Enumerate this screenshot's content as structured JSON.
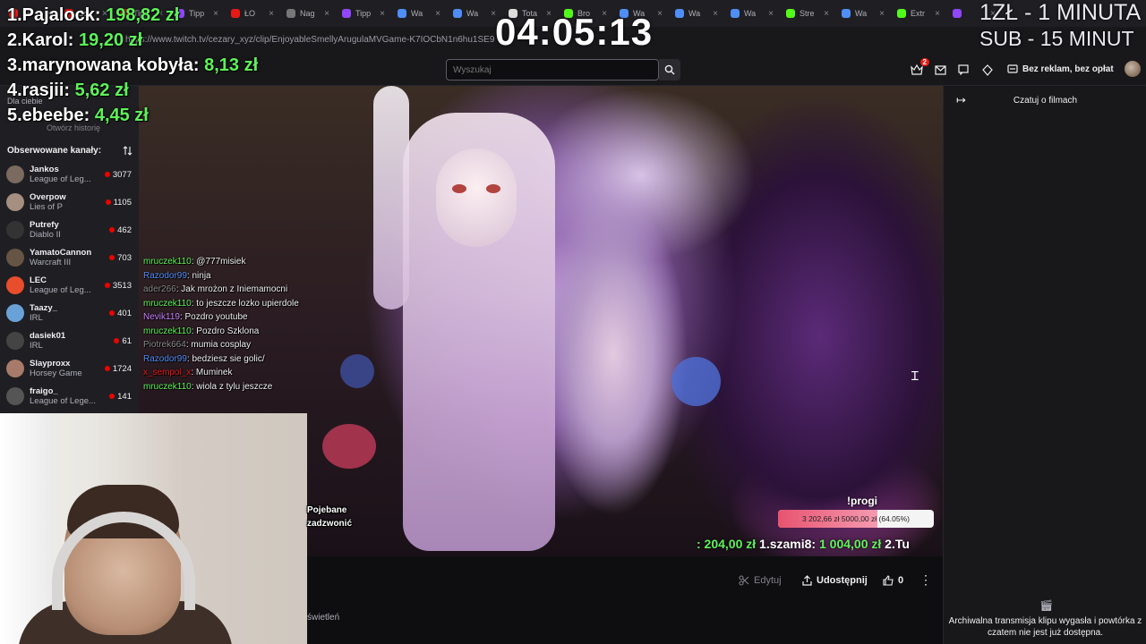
{
  "browser": {
    "tabs": [
      {
        "label": "Si",
        "color": "#e91916"
      },
      {
        "label": "Co",
        "color": "#e91916"
      },
      {
        "label": "Tipp",
        "color": "#e91916"
      },
      {
        "label": "Tipp",
        "color": "#9146ff"
      },
      {
        "label": "ŁO",
        "color": "#e91916"
      },
      {
        "label": "Nag",
        "color": "#777777"
      },
      {
        "label": "Tipp",
        "color": "#9146ff"
      },
      {
        "label": "Wa",
        "color": "#4f8ef7"
      },
      {
        "label": "Wa",
        "color": "#4f8ef7"
      },
      {
        "label": "Tota",
        "color": "#dddddd"
      },
      {
        "label": "Bro",
        "color": "#53fc18"
      },
      {
        "label": "Wa",
        "color": "#4f8ef7"
      },
      {
        "label": "Wa",
        "color": "#4f8ef7"
      },
      {
        "label": "Wa",
        "color": "#4f8ef7"
      },
      {
        "label": "Stre",
        "color": "#53fc18"
      },
      {
        "label": "Wa",
        "color": "#4f8ef7"
      },
      {
        "label": "Extr",
        "color": "#53fc18"
      },
      {
        "label": "",
        "color": "#9146ff"
      }
    ],
    "url": "https://www.twitch.tv/cezary_xyz/clip/EnjoyableSmellyArugulaMVGame-K7IOCbN1n6hu1SE9"
  },
  "topnav": {
    "search_placeholder": "Wyszukaj",
    "notification_count": "2",
    "adfree_label": "Bez reklam, bez opłat"
  },
  "sidebar": {
    "for_you": "Dla ciebie",
    "history": "Otwórz historię",
    "followed_header": "Obserwowane kanały:",
    "channels": [
      {
        "name": "Jankos",
        "game": "League of Leg...",
        "viewers": "3077",
        "color": "#7a6a60"
      },
      {
        "name": "Overpow",
        "game": "Lies of P",
        "viewers": "1105",
        "color": "#a58f80"
      },
      {
        "name": "Putrefy",
        "game": "Diablo II",
        "viewers": "462",
        "color": "#333333"
      },
      {
        "name": "YamatoCannon",
        "game": "Warcraft III",
        "viewers": "703",
        "color": "#665544"
      },
      {
        "name": "LEC",
        "game": "League of Leg...",
        "viewers": "3513",
        "color": "#e84d2c"
      },
      {
        "name": "Taazy_",
        "game": "IRL",
        "viewers": "401",
        "color": "#6aa2d8"
      },
      {
        "name": "dasiek01",
        "game": "IRL",
        "viewers": "61",
        "color": "#444444"
      },
      {
        "name": "Slayproxx",
        "game": "Horsey Game",
        "viewers": "1724",
        "color": "#a87a6a"
      },
      {
        "name": "fraigo_",
        "game": "League of Lege...",
        "viewers": "141",
        "color": "#555555"
      }
    ]
  },
  "overlay": {
    "timer": "04:05:13",
    "leaderboard": [
      {
        "label": "1.Pajalock:",
        "amount": "198,82 zł"
      },
      {
        "label": "2.Karol:",
        "amount": "19,20 zł"
      },
      {
        "label": "3.marynowana kobyła:",
        "amount": "8,13 zł"
      },
      {
        "label": "4.rasjii:",
        "amount": "5,62 zł"
      },
      {
        "label": "5.ebeebe:",
        "amount": "4,45 zł"
      }
    ],
    "sub_line1": "1ZŁ - 1 MINUTA",
    "sub_line2": "SUB - 15 MINUT",
    "progress_title": "!progi",
    "progress_fraction": 0.6405,
    "progress_text": "3 202,66 zł  5000,00 zł (64.05%)",
    "ticker_prefix": ": 204,00 zł",
    "ticker_entry": "1.szami8:",
    "ticker_amount": "1 004,00 zł",
    "ticker_next": "2.Tu",
    "chat": [
      {
        "user": "mruczek110",
        "color": "#5ef25a",
        "msg": "@777misiek"
      },
      {
        "user": "Razodor99",
        "color": "#4f8ef7",
        "msg": "ninja"
      },
      {
        "user": "ader266",
        "color": "#8a8a8a",
        "msg": "Jak mrożon z Iniemamocni"
      },
      {
        "user": "mruczek110",
        "color": "#5ef25a",
        "msg": "to jeszcze lozko upierdole"
      },
      {
        "user": "Nevik119",
        "color": "#c77dff",
        "msg": "Pozdro youtube"
      },
      {
        "user": "mruczek110",
        "color": "#5ef25a",
        "msg": "Pozdro Szklona"
      },
      {
        "user": "Piotrek664",
        "color": "#8a8a8a",
        "msg": "mumia cosplay"
      },
      {
        "user": "Razodor99",
        "color": "#4f8ef7",
        "msg": "bedziesz sie golic/"
      },
      {
        "user": "x_sempol_x",
        "color": "#e91916",
        "msg": "Muminek"
      },
      {
        "user": "mruczek110",
        "color": "#5ef25a",
        "msg": "wiola z tylu jeszcze"
      }
    ],
    "cam_side_1": "Pojebane",
    "cam_side_2": "zadzwonić"
  },
  "actions": {
    "edit": "Edytuj",
    "share": "Udostępnij",
    "likes": "0",
    "footer_text": "świetleń"
  },
  "rightpanel": {
    "title": "Czatuj o filmach",
    "message": "Archiwalna transmisja klipu wygasła i powtórka z czatem nie jest już dostępna."
  }
}
